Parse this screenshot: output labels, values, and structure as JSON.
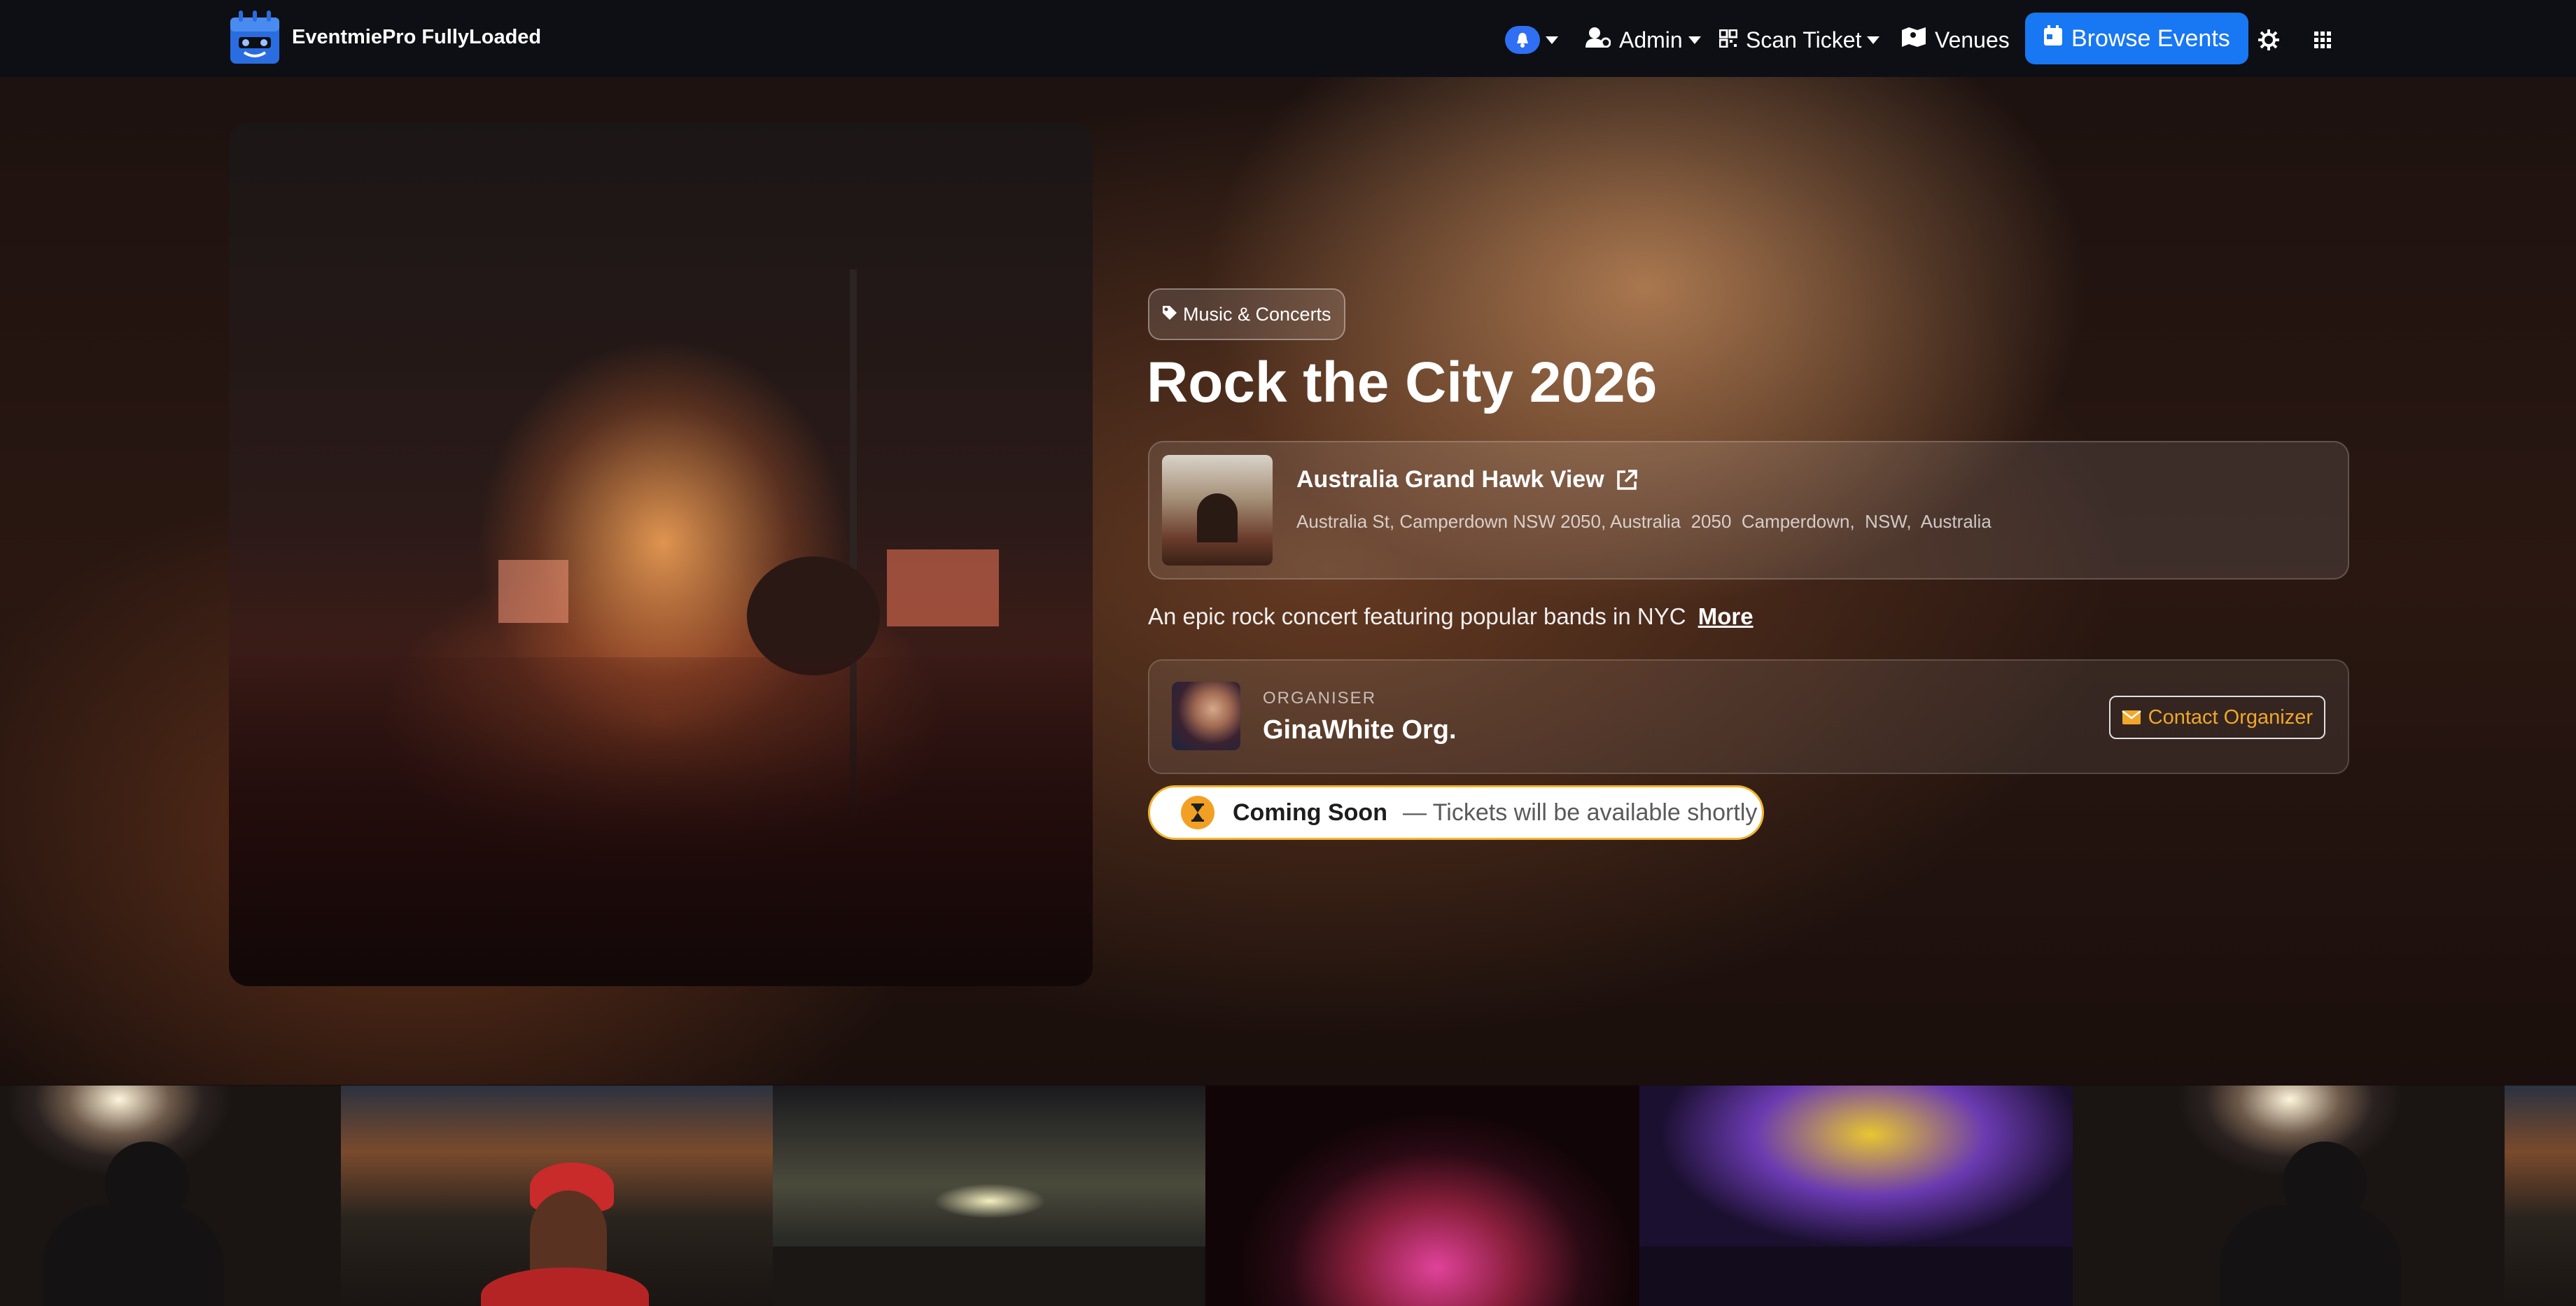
{
  "navbar": {
    "brand_name": "EventmiePro FullyLoaded",
    "admin_label": "Admin",
    "scan_ticket_label": "Scan Ticket",
    "venues_label": "Venues",
    "browse_events_label": "Browse Events",
    "colors": {
      "background": "#0d0f14",
      "primary": "#1877f2"
    },
    "icons": [
      "bell-icon",
      "user-gear-icon",
      "qrcode-icon",
      "map-icon",
      "calendar-icon",
      "gear-icon",
      "grid-icon"
    ]
  },
  "event": {
    "category": "Music & Concerts",
    "title": "Rock the City 2026",
    "excerpt": "An epic rock concert featuring popular bands in NYC",
    "more_label": "More",
    "venue": {
      "name": "Australia Grand Hawk View",
      "address": "Australia St, Camperdown NSW 2050, Australia  2050  Camperdown,  NSW,  Australia"
    },
    "organiser": {
      "label": "ORGANISER",
      "name": "GinaWhite Org.",
      "contact_label": "Contact Organizer"
    },
    "status": {
      "title": "Coming Soon",
      "text": "— Tickets will be available shortly",
      "color": "#f2b431"
    }
  }
}
